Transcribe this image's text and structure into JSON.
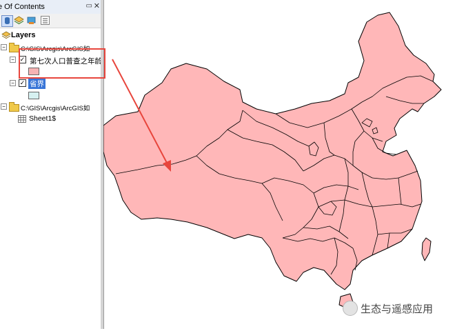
{
  "toc": {
    "title": "e Of Contents",
    "pin_glyph": "📌",
    "close_glyph": "✕",
    "layers_label": "Layers",
    "group1_path": "C:\\GIS\\Arcgis\\ArcGIS如",
    "layer1_name": "第七次人口普查之年龄",
    "layer1_swatch_color": "#f7b3b3",
    "layer2_name": "省界",
    "layer2_swatch_color": "#d6f0f0",
    "group2_path": "C:\\GIS\\Arcgis\\ArcGIS如",
    "table_name": "Sheet1$"
  },
  "map": {
    "fill_color": "#ffb7b8",
    "stroke_color": "#000000"
  },
  "annotation": {
    "highlight_color": "#e8453c"
  },
  "watermark": {
    "text": "生态与遥感应用"
  }
}
